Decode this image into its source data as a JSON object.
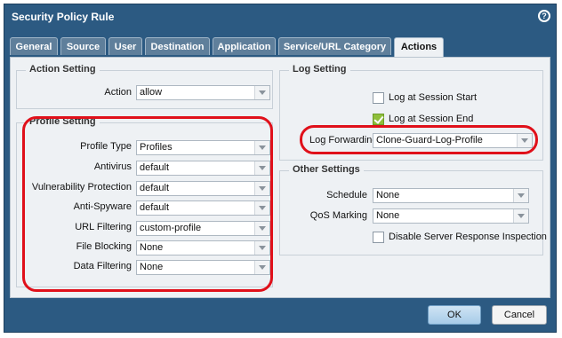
{
  "dialog": {
    "title": "Security Policy Rule",
    "help_icon": "help-icon"
  },
  "tabs": [
    {
      "label": "General",
      "active": false
    },
    {
      "label": "Source",
      "active": false
    },
    {
      "label": "User",
      "active": false
    },
    {
      "label": "Destination",
      "active": false
    },
    {
      "label": "Application",
      "active": false
    },
    {
      "label": "Service/URL Category",
      "active": false
    },
    {
      "label": "Actions",
      "active": true
    }
  ],
  "action_setting": {
    "legend": "Action Setting",
    "action": {
      "label": "Action",
      "value": "allow"
    }
  },
  "profile_setting": {
    "legend": "Profile Setting",
    "rows": [
      {
        "label": "Profile Type",
        "value": "Profiles"
      },
      {
        "label": "Antivirus",
        "value": "default"
      },
      {
        "label": "Vulnerability Protection",
        "value": "default"
      },
      {
        "label": "Anti-Spyware",
        "value": "default"
      },
      {
        "label": "URL Filtering",
        "value": "custom-profile"
      },
      {
        "label": "File Blocking",
        "value": "None"
      },
      {
        "label": "Data Filtering",
        "value": "None"
      }
    ]
  },
  "log_setting": {
    "legend": "Log Setting",
    "log_start": {
      "label": "Log at Session Start",
      "checked": false
    },
    "log_end": {
      "label": "Log at Session End",
      "checked": true
    },
    "log_forwarding": {
      "label": "Log Forwarding",
      "value": "Clone-Guard-Log-Profile"
    }
  },
  "other_settings": {
    "legend": "Other Settings",
    "schedule": {
      "label": "Schedule",
      "value": "None"
    },
    "qos": {
      "label": "QoS Marking",
      "value": "None"
    },
    "disable_sri": {
      "label": "Disable Server Response Inspection",
      "checked": false
    }
  },
  "buttons": {
    "ok": "OK",
    "cancel": "Cancel"
  },
  "colors": {
    "titlebar": "#2c5a82",
    "highlight": "#e0101a",
    "checkbox_checked": "#8fbf3a"
  }
}
